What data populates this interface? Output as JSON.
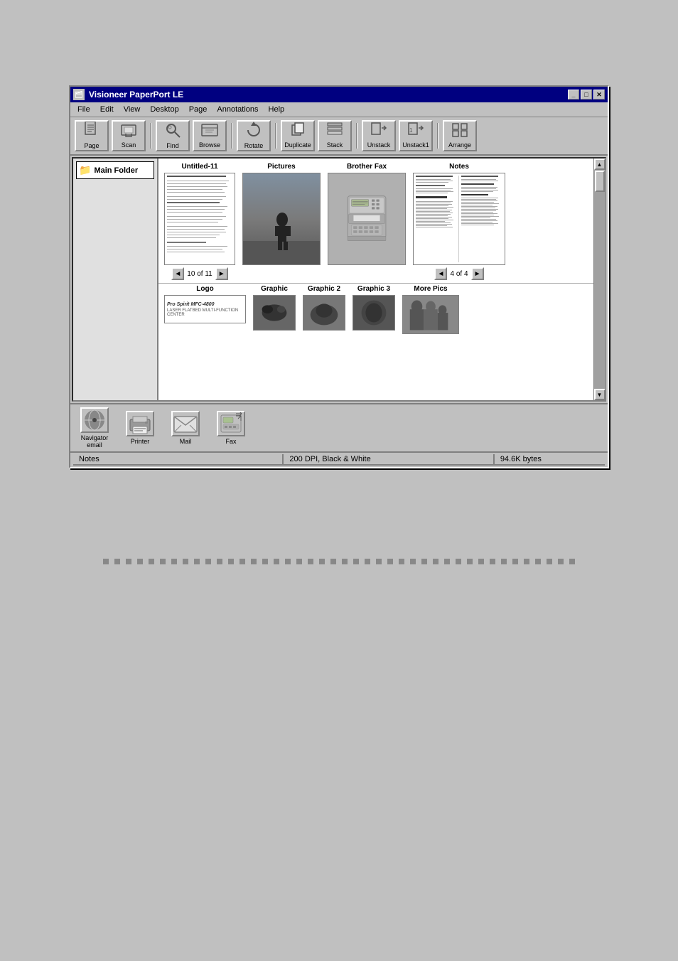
{
  "window": {
    "title": "Visioneer PaperPort LE",
    "minimize_label": "_",
    "maximize_label": "□",
    "close_label": "✕"
  },
  "menu": {
    "items": [
      "File",
      "Edit",
      "View",
      "Desktop",
      "Page",
      "Annotations",
      "Help"
    ]
  },
  "toolbar": {
    "buttons": [
      {
        "id": "page",
        "label": "Page",
        "icon": "📄"
      },
      {
        "id": "scan",
        "label": "Scan",
        "icon": "🖨"
      },
      {
        "id": "find",
        "label": "Find",
        "icon": "🔍"
      },
      {
        "id": "browse",
        "label": "Browse",
        "icon": "📋"
      },
      {
        "id": "rotate",
        "label": "Rotate",
        "icon": "↺"
      },
      {
        "id": "duplicate",
        "label": "Duplicate",
        "icon": "⧉"
      },
      {
        "id": "stack",
        "label": "Stack",
        "icon": "⬛"
      },
      {
        "id": "unstack",
        "label": "Unstack",
        "icon": "📤"
      },
      {
        "id": "unstack1",
        "label": "Unstack1",
        "icon": "📤"
      },
      {
        "id": "arrange",
        "label": "Arrange",
        "icon": "⊞"
      }
    ]
  },
  "sidebar": {
    "folder_label": "Main Folder"
  },
  "documents": {
    "untitled": {
      "title": "Untitled-11",
      "nav_text": "10 of 11"
    },
    "pictures": {
      "title": "Pictures"
    },
    "brother_fax": {
      "title": "Brother Fax"
    },
    "notes": {
      "title": "Notes",
      "nav_text": "4 of 4"
    }
  },
  "bottom_docs": {
    "logo": {
      "title": "Logo",
      "brand": "Pro Spirit MFC-4800",
      "sub": "LASER FLATBED MULTI-FUNCTION CENTER"
    },
    "graphic": {
      "title": "Graphic"
    },
    "graphic2": {
      "title": "Graphic 2"
    },
    "graphic3": {
      "title": "Graphic 3"
    },
    "more_pics": {
      "title": "More Pics"
    }
  },
  "send_area": {
    "buttons": [
      {
        "id": "navigator",
        "label": "Navigator\nemail",
        "icon": "🌐"
      },
      {
        "id": "printer",
        "label": "Printer",
        "icon": "🖨"
      },
      {
        "id": "mail",
        "label": "Mail",
        "icon": "✉"
      },
      {
        "id": "fax",
        "label": "Fax",
        "icon": "📠"
      }
    ]
  },
  "status_bar": {
    "section1": "Notes",
    "section2": "200 DPI, Black & White",
    "section3": "94.6K bytes"
  },
  "dots": {
    "count": 42,
    "color": "#888888"
  }
}
